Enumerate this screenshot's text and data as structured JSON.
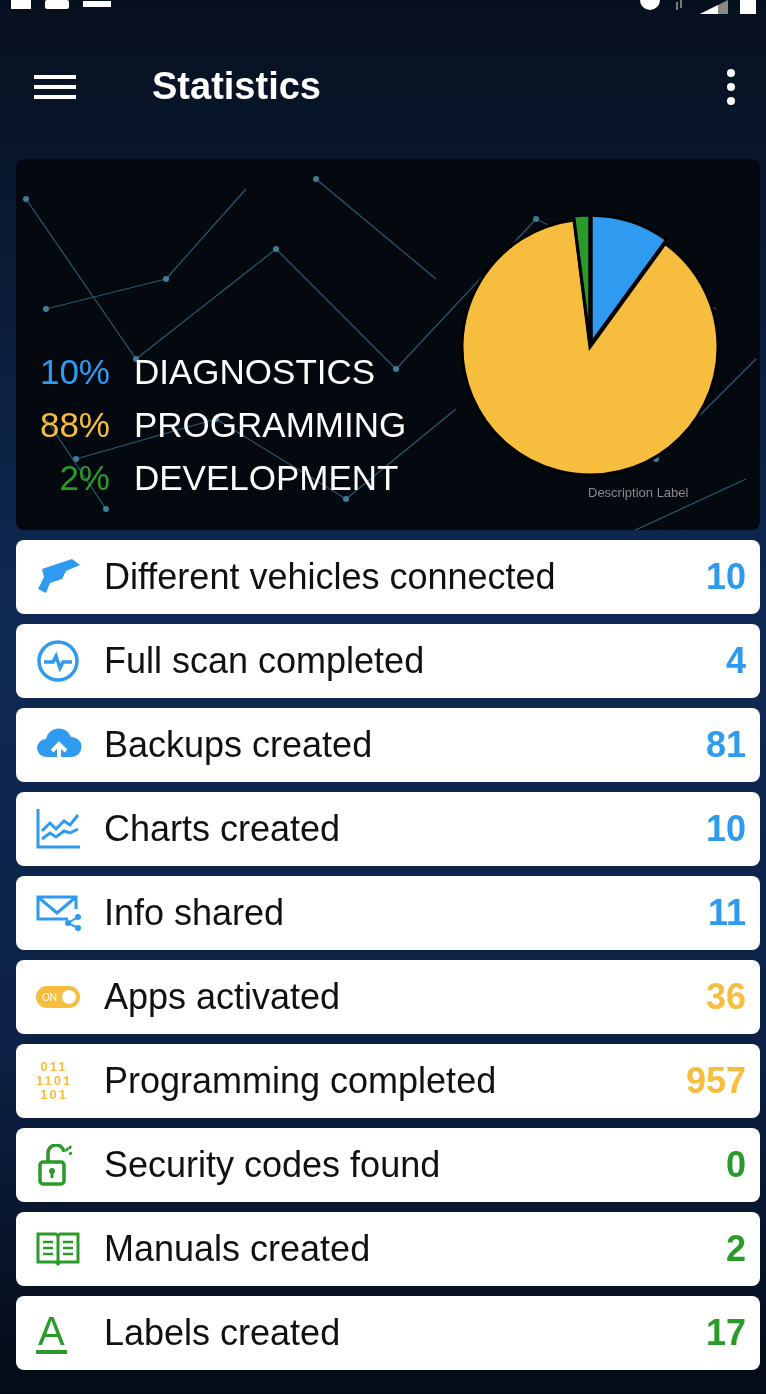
{
  "app_bar": {
    "title": "Statistics"
  },
  "summary": {
    "chart_data": {
      "type": "pie",
      "categories": [
        "DIAGNOSTICS",
        "PROGRAMMING",
        "DEVELOPMENT"
      ],
      "values": [
        10,
        88,
        2
      ],
      "value_labels": [
        "10%",
        "88%",
        "2%"
      ],
      "colors": [
        "#2e9bf0",
        "#f7bd3f",
        "#2a9a2a"
      ]
    },
    "description": "Description Label"
  },
  "stats": [
    {
      "kind": "vehicle",
      "label": "Different vehicles connected",
      "value": "10",
      "color": "#2e9bf0"
    },
    {
      "kind": "scan",
      "label": "Full scan completed",
      "value": "4",
      "color": "#2e9bf0"
    },
    {
      "kind": "backup",
      "label": "Backups created",
      "value": "81",
      "color": "#2e9bf0"
    },
    {
      "kind": "chart",
      "label": "Charts created",
      "value": "10",
      "color": "#2e9bf0"
    },
    {
      "kind": "share",
      "label": "Info shared",
      "value": "11",
      "color": "#2e9bf0"
    },
    {
      "kind": "toggle",
      "label": "Apps activated",
      "value": "36",
      "color": "#f7bd3f",
      "icon_text": [
        "ON"
      ]
    },
    {
      "kind": "binary",
      "label": "Programming completed",
      "value": "957",
      "color": "#f7bd3f",
      "icon_text": [
        "011",
        "1101",
        "101"
      ]
    },
    {
      "kind": "lock",
      "label": "Security codes found",
      "value": "0",
      "color": "#2a9a2a"
    },
    {
      "kind": "manual",
      "label": "Manuals created",
      "value": "2",
      "color": "#2a9a2a"
    },
    {
      "kind": "letter",
      "label": "Labels created",
      "value": "17",
      "color": "#2a9a2a",
      "icon_text": [
        "A"
      ]
    }
  ]
}
